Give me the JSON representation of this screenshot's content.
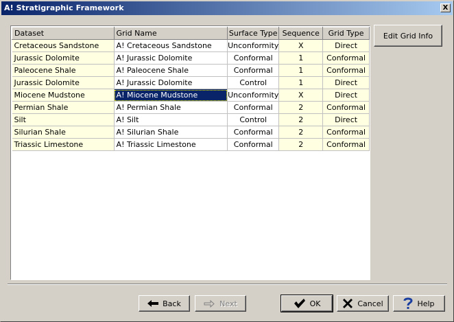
{
  "window": {
    "title": "A! Stratigraphic Framework",
    "close_glyph": "X"
  },
  "table": {
    "columns": [
      "Dataset",
      "Grid Name",
      "Surface Type",
      "Sequence",
      "Grid Type"
    ],
    "rows": [
      [
        "Cretaceous Sandstone",
        "A! Cretaceous Sandstone",
        "Unconformity",
        "X",
        "Direct"
      ],
      [
        "Jurassic Dolomite",
        "A! Jurassic Dolomite",
        "Conformal",
        "1",
        "Conformal"
      ],
      [
        "Paleocene Shale",
        "A! Paleocene Shale",
        "Conformal",
        "1",
        "Conformal"
      ],
      [
        "Jurassic Dolomite",
        "A! Jurassic Dolomite",
        "Control",
        "1",
        "Direct"
      ],
      [
        "Miocene Mudstone",
        "A! Miocene Mudstone",
        "Unconformity",
        "X",
        "Direct"
      ],
      [
        "Permian Shale",
        "A! Permian Shale",
        "Conformal",
        "2",
        "Conformal"
      ],
      [
        "Silt",
        "A! Silt",
        "Control",
        "2",
        "Direct"
      ],
      [
        "Silurian Shale",
        "A! Silurian Shale",
        "Conformal",
        "2",
        "Conformal"
      ],
      [
        "Triassic Limestone",
        "A! Triassic Limestone",
        "Conformal",
        "2",
        "Conformal"
      ]
    ]
  },
  "buttons": {
    "edit_grid_info": "Edit Grid Info",
    "back": "Back",
    "next": "Next",
    "ok": "OK",
    "cancel": "Cancel",
    "help": "Help"
  },
  "colors": {
    "title_start": "#0a246a",
    "title_end": "#a6caf0",
    "readonly_cell": "#ffffe1",
    "selection": "#0a246a"
  },
  "icons": {
    "back": "arrow-left-icon",
    "next": "arrow-right-icon",
    "ok": "checkmark-icon",
    "cancel": "x-icon",
    "help": "question-icon"
  }
}
